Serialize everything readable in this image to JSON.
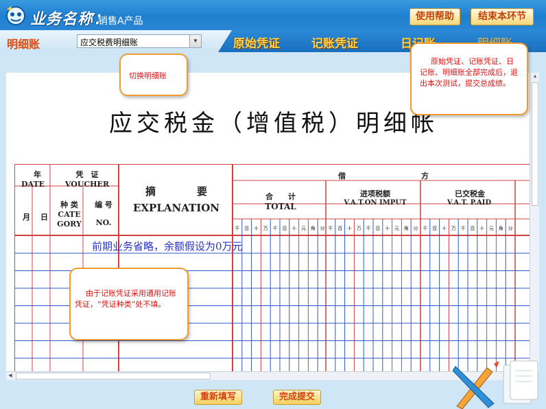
{
  "header": {
    "app_title": "业务名称：",
    "biz_name": "销售A产品",
    "help_button": "使用帮助",
    "end_button": "结束本环节"
  },
  "nav": {
    "section_label": "明细账",
    "select_value": "应交税费明细账",
    "tabs": [
      {
        "label": "原始凭证"
      },
      {
        "label": "记账凭证"
      },
      {
        "label": "日记账"
      },
      {
        "label": "明细账"
      }
    ]
  },
  "ledger": {
    "title": "应交税金（增值税）明细帐",
    "year": "年",
    "month": "月",
    "day": "日",
    "date": "DATE",
    "voucher_cn": "凭　证",
    "voucher": "VOUCHER",
    "category_cn": "种 类",
    "category": "CATE GORY",
    "number_cn": "编 号",
    "number": "NO.",
    "explanation_cn": "摘　　　　要",
    "explanation": "EXPLANATION",
    "debit": "借　　　　　　　　　　方",
    "total_cn": "合　　计",
    "total": "TOTAL",
    "input_tax_cn": "进项税额",
    "input_tax": "V.A.T.ON IMPUT",
    "paid_tax_cn": "已交税金",
    "paid_tax": "V.A.T. P.AID",
    "digit_units": [
      "千",
      "百",
      "十",
      "万",
      "千",
      "百",
      "十",
      "元",
      "角",
      "分"
    ],
    "memo": "前期业务省略，余额假设为0万元"
  },
  "callouts": {
    "switch_ledger": "切换明细账",
    "finish_note": "原始凭证、记账凭证、日记账、明细账全部完成后，退出本次测试，提交总成绩。",
    "voucher_note": "由于记账凭证采用通用记账凭证，“凭证种类”处不填。"
  },
  "footer": {
    "redo_button": "重新填写",
    "submit_button": "完成提交"
  },
  "colors": {
    "header_blue": "#1f7fd0",
    "tab_text": "#ffd24a",
    "callout_border": "#f29a2e",
    "ledger_red": "#d04040",
    "ledger_blue": "#2f55c8"
  }
}
